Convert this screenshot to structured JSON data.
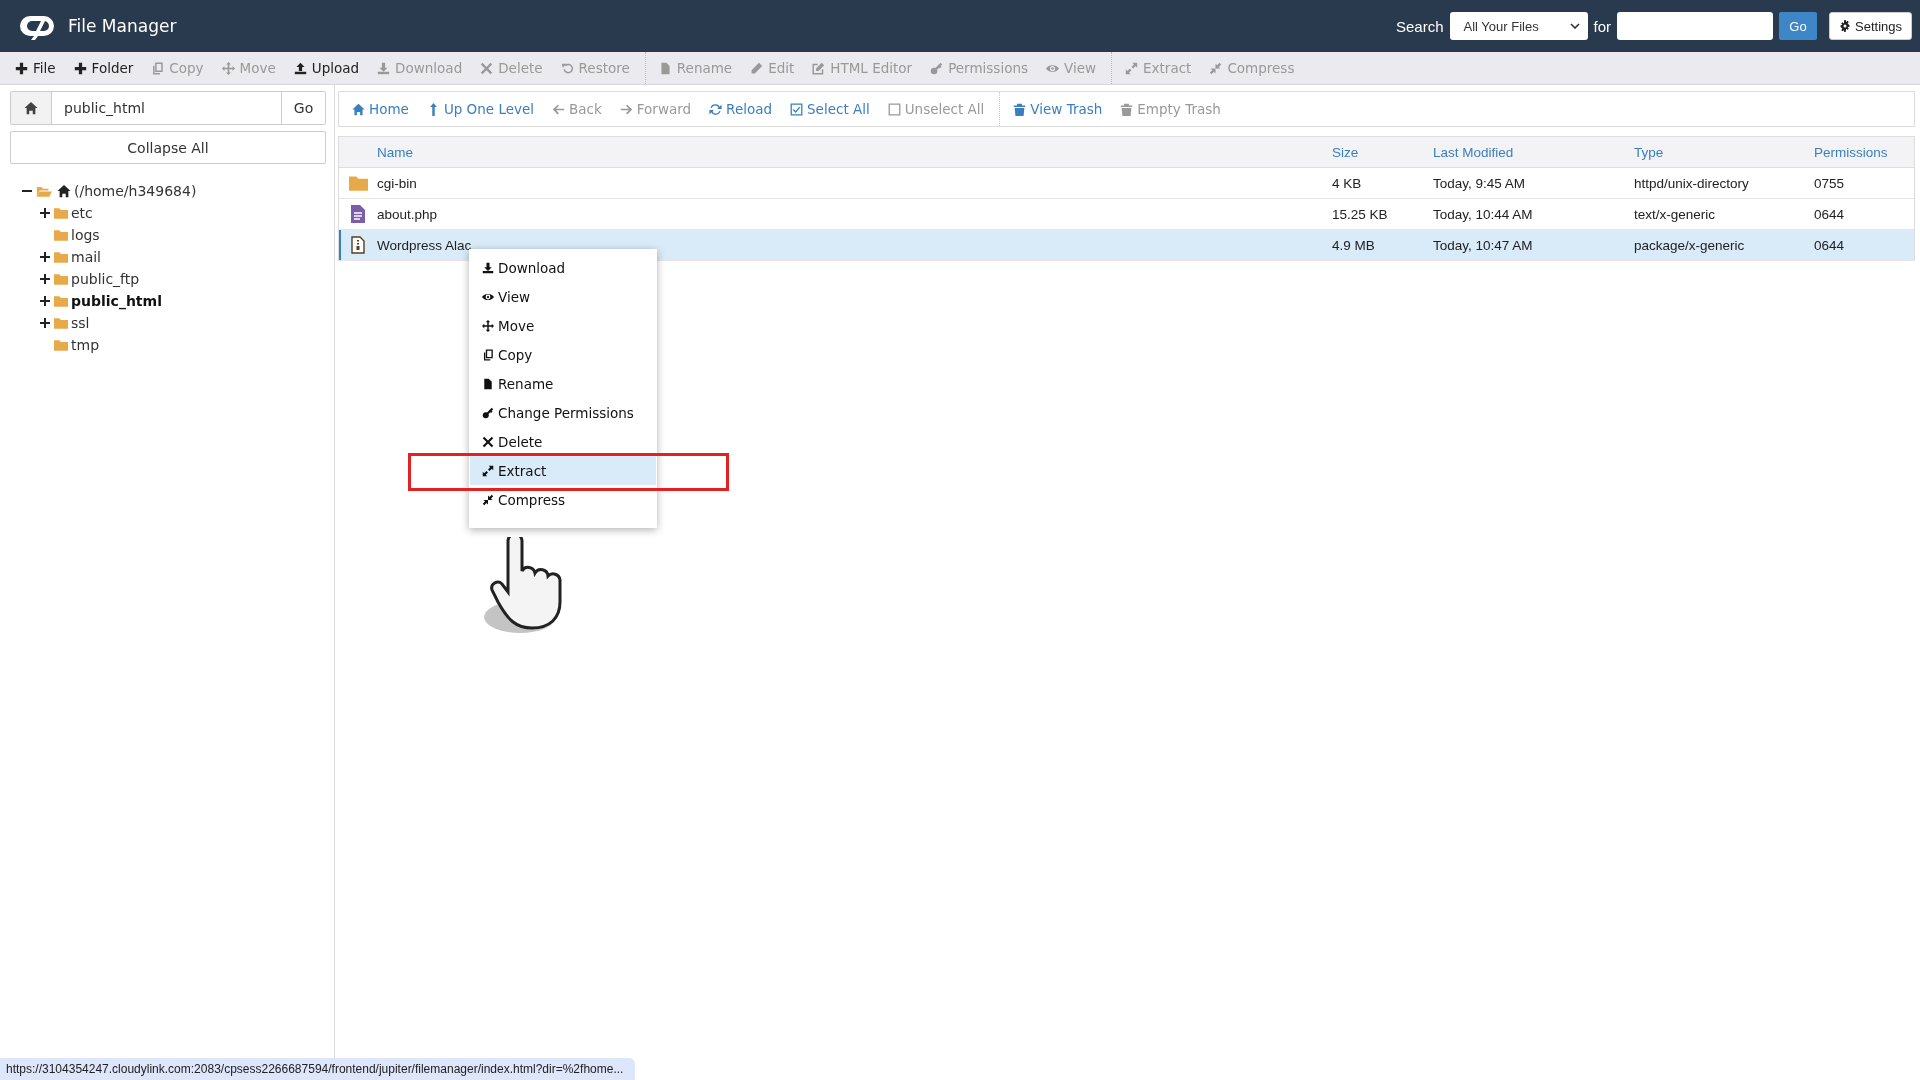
{
  "app": {
    "title": "File Manager"
  },
  "search": {
    "label": "Search",
    "scope": "All Your Files",
    "for_label": "for",
    "button": "Go",
    "settings": "Settings"
  },
  "toolbar": [
    [
      {
        "label": "File",
        "disabled": false
      },
      {
        "label": "Folder",
        "disabled": false
      },
      {
        "label": "Copy",
        "disabled": true
      },
      {
        "label": "Move",
        "disabled": true
      },
      {
        "label": "Upload",
        "disabled": false
      },
      {
        "label": "Download",
        "disabled": true
      },
      {
        "label": "Delete",
        "disabled": true
      },
      {
        "label": "Restore",
        "disabled": true
      }
    ],
    [
      {
        "label": "Rename",
        "disabled": true
      },
      {
        "label": "Edit",
        "disabled": true
      },
      {
        "label": "HTML Editor",
        "disabled": true
      },
      {
        "label": "Permissions",
        "disabled": true
      },
      {
        "label": "View",
        "disabled": true
      }
    ],
    [
      {
        "label": "Extract",
        "disabled": true
      },
      {
        "label": "Compress",
        "disabled": true
      }
    ]
  ],
  "path_bar": {
    "value": "public_html",
    "button": "Go"
  },
  "collapse_button": "Collapse All",
  "tree": [
    {
      "label": "(/home/h349684)",
      "expandable": true,
      "expanded": true,
      "selected": false,
      "children": [
        {
          "label": "etc",
          "expandable": true,
          "expanded": false,
          "selected": false
        },
        {
          "label": "logs",
          "expandable": false,
          "expanded": false,
          "selected": false
        },
        {
          "label": "mail",
          "expandable": true,
          "expanded": false,
          "selected": false
        },
        {
          "label": "public_ftp",
          "expandable": true,
          "expanded": false,
          "selected": false
        },
        {
          "label": "public_html",
          "expandable": true,
          "expanded": false,
          "selected": true
        },
        {
          "label": "ssl",
          "expandable": true,
          "expanded": false,
          "selected": false
        },
        {
          "label": "tmp",
          "expandable": false,
          "expanded": false,
          "selected": false
        }
      ]
    }
  ],
  "nav": [
    [
      {
        "label": "Home",
        "disabled": false
      },
      {
        "label": "Up One Level",
        "disabled": false
      },
      {
        "label": "Back",
        "disabled": true
      },
      {
        "label": "Forward",
        "disabled": true
      },
      {
        "label": "Reload",
        "disabled": false
      },
      {
        "label": "Select All",
        "disabled": false
      },
      {
        "label": "Unselect All",
        "disabled": true
      }
    ],
    [
      {
        "label": "View Trash",
        "disabled": false
      },
      {
        "label": "Empty Trash",
        "disabled": true
      }
    ]
  ],
  "table": {
    "columns": [
      "Name",
      "Size",
      "Last Modified",
      "Type",
      "Permissions"
    ],
    "rows": [
      {
        "kind": "folder",
        "name": "cgi-bin",
        "size": "4 KB",
        "modified": "Today, 9:45 AM",
        "type": "httpd/unix-directory",
        "permissions": "0755",
        "selected": false
      },
      {
        "kind": "php",
        "name": "about.php",
        "size": "15.25 KB",
        "modified": "Today, 10:44 AM",
        "type": "text/x-generic",
        "permissions": "0644",
        "selected": false
      },
      {
        "kind": "archive",
        "name": "Wordpress Alac",
        "size": "4.9 MB",
        "modified": "Today, 10:47 AM",
        "type": "package/x-generic",
        "permissions": "0644",
        "selected": true
      }
    ]
  },
  "context_menu": [
    {
      "label": "Download",
      "selected": false
    },
    {
      "label": "View",
      "selected": false
    },
    {
      "label": "Move",
      "selected": false
    },
    {
      "label": "Copy",
      "selected": false
    },
    {
      "label": "Rename",
      "selected": false
    },
    {
      "label": "Change Permissions",
      "selected": false
    },
    {
      "label": "Delete",
      "selected": false
    },
    {
      "label": "Extract",
      "selected": true
    },
    {
      "label": "Compress",
      "selected": false
    }
  ],
  "status_url": "https://3104354247.cloudylink.com:2083/cpsess2266687594/frontend/jupiter/filemanager/index.html?dir=%2fhome..."
}
